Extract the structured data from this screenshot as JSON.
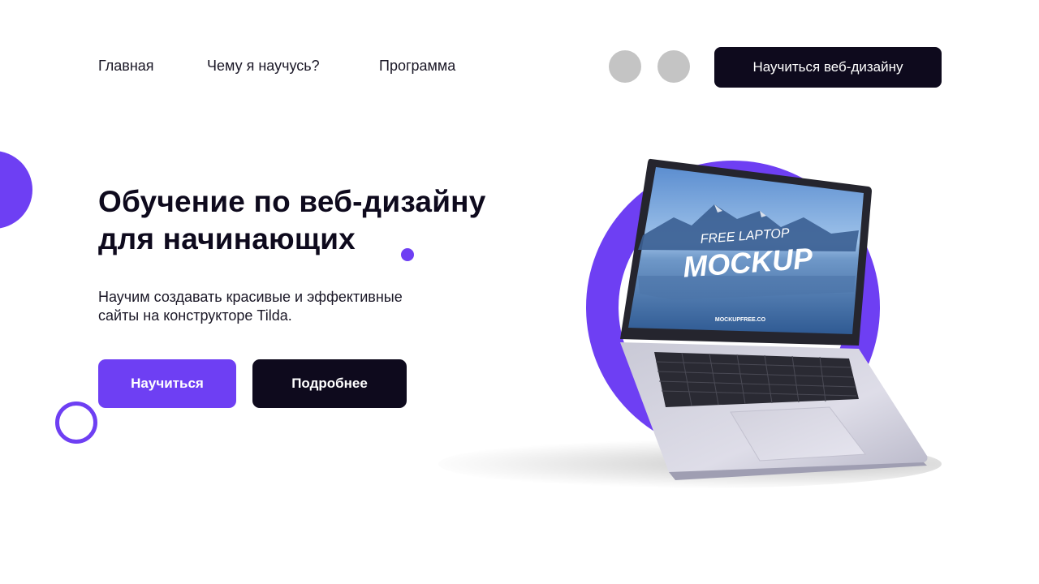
{
  "nav": {
    "links": [
      "Главная",
      "Чему я научусь?",
      "Программа"
    ],
    "cta_label": "Научиться веб-дизайну"
  },
  "hero": {
    "title_lines": [
      "Обучение по веб-дизайну",
      "для начинающих"
    ],
    "subtitle_lines": [
      "Научим создавать красивые и эффективные",
      "сайты на конструкторе Tilda."
    ],
    "primary_button": "Научиться",
    "secondary_button": "Подробнее"
  },
  "mockup": {
    "small_caption": "FREE LAPTOP",
    "big_caption": "MOCKUP",
    "brand": "MOCKUPFREE.CO"
  },
  "colors": {
    "accent": "#6e3ff3",
    "dark": "#0e0a1d",
    "placeholder": "#c4c4c4"
  }
}
